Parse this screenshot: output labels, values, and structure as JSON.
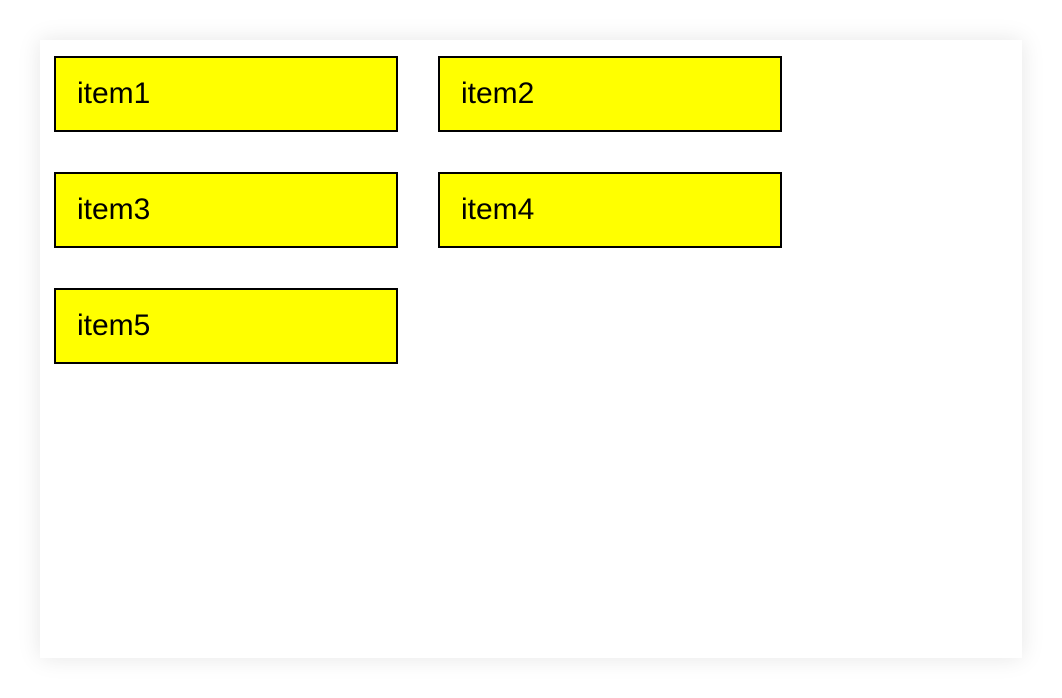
{
  "colors": {
    "item_background": "#ffff00",
    "item_border": "#000000",
    "page_background": "#ffffff"
  },
  "items": [
    {
      "label": "item1"
    },
    {
      "label": "item2"
    },
    {
      "label": "item3"
    },
    {
      "label": "item4"
    },
    {
      "label": "item5"
    }
  ]
}
